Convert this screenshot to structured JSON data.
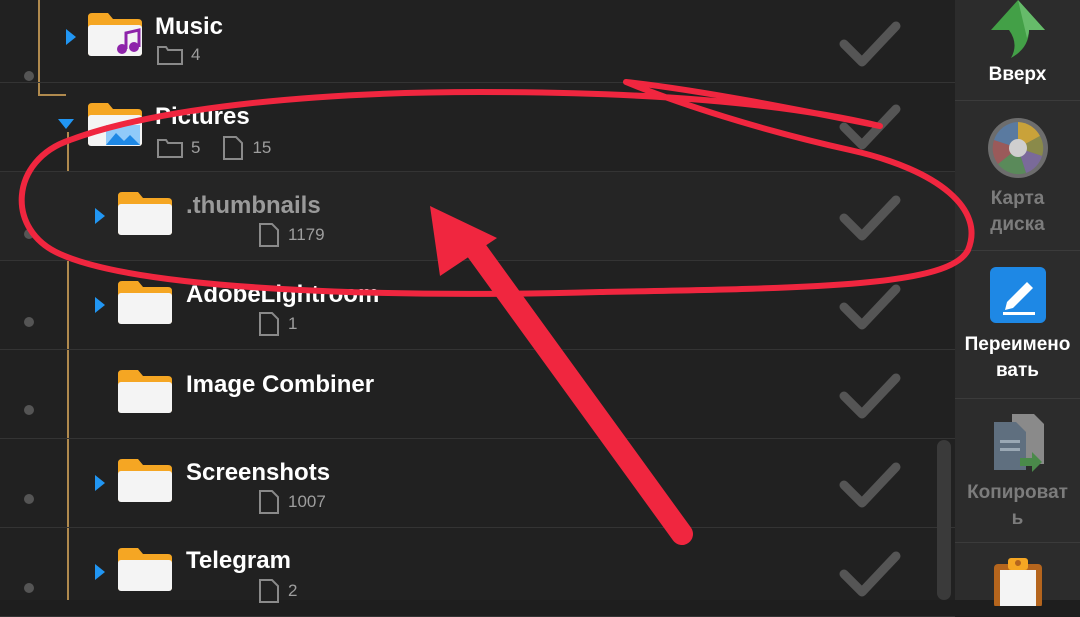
{
  "folders": [
    {
      "name": "Music",
      "folders": "4"
    },
    {
      "name": "Pictures",
      "folders": "5",
      "files": "15"
    },
    {
      "name": ".thumbnails",
      "files": "1179"
    },
    {
      "name": "AdobeLightroom",
      "files": "1"
    },
    {
      "name": "Image Combiner"
    },
    {
      "name": "Screenshots",
      "files": "1007"
    },
    {
      "name": "Telegram",
      "files": "2"
    }
  ],
  "sidebar": {
    "up": "Вверх",
    "disk_map": "Карта диска",
    "rename": "Переимено вать",
    "copy": "Копироват ь"
  },
  "colors": {
    "accent": "#2196f3",
    "folder": "#f5a623",
    "annotation": "#f0263f"
  }
}
